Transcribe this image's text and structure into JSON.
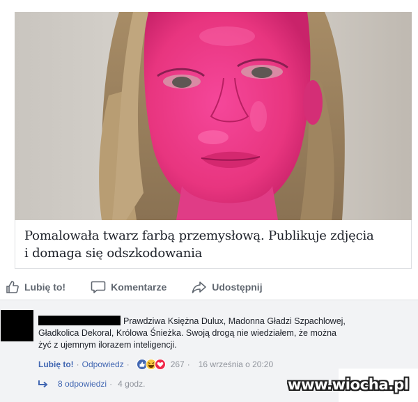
{
  "post": {
    "image": {
      "subject": "face-painted-pink-photo"
    },
    "link_title_line1": "Pomalowała twarz farbą przemysłową. Publikuje zdjęcia",
    "link_title_line2": "i domaga się odszkodowania"
  },
  "actions": {
    "like_label": "Lubię to!",
    "comment_label": "Komentarze",
    "share_label": "Udostępnij"
  },
  "comment": {
    "text_line1": "Prawdziwa Księżna Dulux, Madonna Gładzi Szpachlowej,",
    "text_line2": "Gładkolica Dekoral, Królowa Śnieżka. Swoją drogą nie wiedziałem, że można",
    "text_line3": "żyć z ujemnym ilorazem inteligencji.",
    "like_label": "Lubię to!",
    "reply_label": "Odpowiedz",
    "reaction_count": "267",
    "timestamp": "16 września o 20:20",
    "replies_label": "8 odpowiedzi",
    "replies_age": "4 godz.",
    "separator": "·"
  },
  "watermark": {
    "text": "www.wiocha.pl"
  },
  "colors": {
    "link_blue": "#4267b2",
    "muted_gray": "#90949c",
    "action_gray": "#606770",
    "comment_bg": "#f2f3f5",
    "paint_pink": "#e8357f"
  },
  "icons": [
    "thumbs-up-icon",
    "comment-bubble-icon",
    "share-arrow-icon",
    "like-reaction-icon",
    "haha-reaction-icon",
    "love-reaction-icon",
    "reply-arrow-icon"
  ]
}
